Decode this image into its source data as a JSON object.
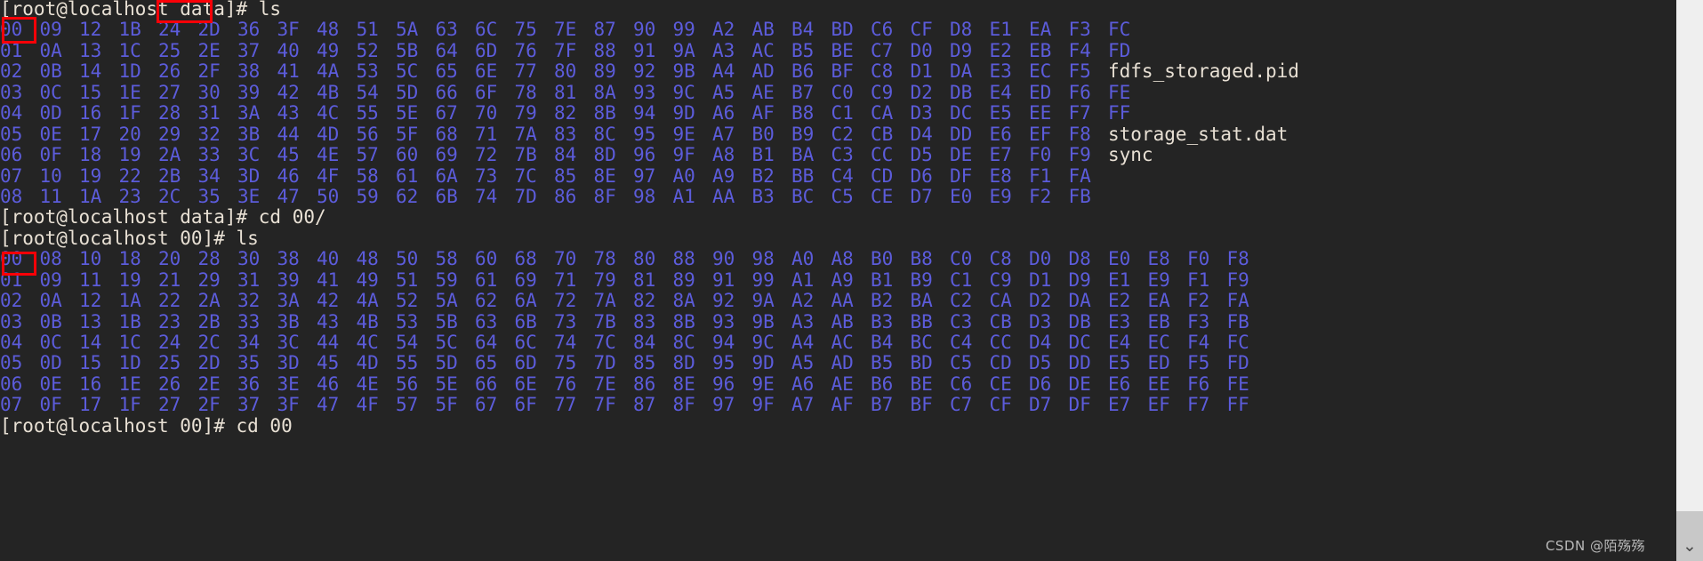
{
  "terminal": {
    "background_color": "#242424",
    "prompt_color": "#e8e0d4",
    "directory_color": "#5c5cdb",
    "filename_color": "#e8e0d4",
    "annotation_color": "#fb0007",
    "lines": [
      {
        "type": "prompt",
        "text": "[root@localhost data]# ls"
      },
      {
        "type": "dirs",
        "cells": [
          "00",
          "09",
          "12",
          "1B",
          "24",
          "2D",
          "36",
          "3F",
          "48",
          "51",
          "5A",
          "63",
          "6C",
          "75",
          "7E",
          "87",
          "90",
          "99",
          "A2",
          "AB",
          "B4",
          "BD",
          "C6",
          "CF",
          "D8",
          "E1",
          "EA",
          "F3",
          "FC"
        ],
        "filename": ""
      },
      {
        "type": "dirs",
        "cells": [
          "01",
          "0A",
          "13",
          "1C",
          "25",
          "2E",
          "37",
          "40",
          "49",
          "52",
          "5B",
          "64",
          "6D",
          "76",
          "7F",
          "88",
          "91",
          "9A",
          "A3",
          "AC",
          "B5",
          "BE",
          "C7",
          "D0",
          "D9",
          "E2",
          "EB",
          "F4",
          "FD"
        ],
        "filename": ""
      },
      {
        "type": "dirs",
        "cells": [
          "02",
          "0B",
          "14",
          "1D",
          "26",
          "2F",
          "38",
          "41",
          "4A",
          "53",
          "5C",
          "65",
          "6E",
          "77",
          "80",
          "89",
          "92",
          "9B",
          "A4",
          "AD",
          "B6",
          "BF",
          "C8",
          "D1",
          "DA",
          "E3",
          "EC",
          "F5"
        ],
        "filename": "fdfs_storaged.pid"
      },
      {
        "type": "dirs",
        "cells": [
          "03",
          "0C",
          "15",
          "1E",
          "27",
          "30",
          "39",
          "42",
          "4B",
          "54",
          "5D",
          "66",
          "6F",
          "78",
          "81",
          "8A",
          "93",
          "9C",
          "A5",
          "AE",
          "B7",
          "C0",
          "C9",
          "D2",
          "DB",
          "E4",
          "ED",
          "F6",
          "FE"
        ],
        "filename": ""
      },
      {
        "type": "dirs",
        "cells": [
          "04",
          "0D",
          "16",
          "1F",
          "28",
          "31",
          "3A",
          "43",
          "4C",
          "55",
          "5E",
          "67",
          "70",
          "79",
          "82",
          "8B",
          "94",
          "9D",
          "A6",
          "AF",
          "B8",
          "C1",
          "CA",
          "D3",
          "DC",
          "E5",
          "EE",
          "F7",
          "FF"
        ],
        "filename": ""
      },
      {
        "type": "dirs",
        "cells": [
          "05",
          "0E",
          "17",
          "20",
          "29",
          "32",
          "3B",
          "44",
          "4D",
          "56",
          "5F",
          "68",
          "71",
          "7A",
          "83",
          "8C",
          "95",
          "9E",
          "A7",
          "B0",
          "B9",
          "C2",
          "CB",
          "D4",
          "DD",
          "E6",
          "EF",
          "F8"
        ],
        "filename": "storage_stat.dat"
      },
      {
        "type": "dirs",
        "cells": [
          "06",
          "0F",
          "18",
          "19",
          "2A",
          "33",
          "3C",
          "45",
          "4E",
          "57",
          "60",
          "69",
          "72",
          "7B",
          "84",
          "8D",
          "96",
          "9F",
          "A8",
          "B1",
          "BA",
          "C3",
          "CC",
          "D5",
          "DE",
          "E7",
          "F0",
          "F9"
        ],
        "filename": "sync"
      },
      {
        "type": "dirs",
        "cells": [
          "07",
          "10",
          "19",
          "22",
          "2B",
          "34",
          "3D",
          "46",
          "4F",
          "58",
          "61",
          "6A",
          "73",
          "7C",
          "85",
          "8E",
          "97",
          "A0",
          "A9",
          "B2",
          "BB",
          "C4",
          "CD",
          "D6",
          "DF",
          "E8",
          "F1",
          "FA"
        ],
        "filename": ""
      },
      {
        "type": "dirs",
        "cells": [
          "08",
          "11",
          "1A",
          "23",
          "2C",
          "35",
          "3E",
          "47",
          "50",
          "59",
          "62",
          "6B",
          "74",
          "7D",
          "86",
          "8F",
          "98",
          "A1",
          "AA",
          "B3",
          "BC",
          "C5",
          "CE",
          "D7",
          "E0",
          "E9",
          "F2",
          "FB"
        ],
        "filename": ""
      },
      {
        "type": "prompt",
        "text": "[root@localhost data]# cd 00/"
      },
      {
        "type": "prompt",
        "text": "[root@localhost 00]# ls"
      },
      {
        "type": "dirs",
        "cells": [
          "00",
          "08",
          "10",
          "18",
          "20",
          "28",
          "30",
          "38",
          "40",
          "48",
          "50",
          "58",
          "60",
          "68",
          "70",
          "78",
          "80",
          "88",
          "90",
          "98",
          "A0",
          "A8",
          "B0",
          "B8",
          "C0",
          "C8",
          "D0",
          "D8",
          "E0",
          "E8",
          "F0",
          "F8"
        ],
        "filename": ""
      },
      {
        "type": "dirs",
        "cells": [
          "01",
          "09",
          "11",
          "19",
          "21",
          "29",
          "31",
          "39",
          "41",
          "49",
          "51",
          "59",
          "61",
          "69",
          "71",
          "79",
          "81",
          "89",
          "91",
          "99",
          "A1",
          "A9",
          "B1",
          "B9",
          "C1",
          "C9",
          "D1",
          "D9",
          "E1",
          "E9",
          "F1",
          "F9"
        ],
        "filename": ""
      },
      {
        "type": "dirs",
        "cells": [
          "02",
          "0A",
          "12",
          "1A",
          "22",
          "2A",
          "32",
          "3A",
          "42",
          "4A",
          "52",
          "5A",
          "62",
          "6A",
          "72",
          "7A",
          "82",
          "8A",
          "92",
          "9A",
          "A2",
          "AA",
          "B2",
          "BA",
          "C2",
          "CA",
          "D2",
          "DA",
          "E2",
          "EA",
          "F2",
          "FA"
        ],
        "filename": ""
      },
      {
        "type": "dirs",
        "cells": [
          "03",
          "0B",
          "13",
          "1B",
          "23",
          "2B",
          "33",
          "3B",
          "43",
          "4B",
          "53",
          "5B",
          "63",
          "6B",
          "73",
          "7B",
          "83",
          "8B",
          "93",
          "9B",
          "A3",
          "AB",
          "B3",
          "BB",
          "C3",
          "CB",
          "D3",
          "DB",
          "E3",
          "EB",
          "F3",
          "FB"
        ],
        "filename": ""
      },
      {
        "type": "dirs",
        "cells": [
          "04",
          "0C",
          "14",
          "1C",
          "24",
          "2C",
          "34",
          "3C",
          "44",
          "4C",
          "54",
          "5C",
          "64",
          "6C",
          "74",
          "7C",
          "84",
          "8C",
          "94",
          "9C",
          "A4",
          "AC",
          "B4",
          "BC",
          "C4",
          "CC",
          "D4",
          "DC",
          "E4",
          "EC",
          "F4",
          "FC"
        ],
        "filename": ""
      },
      {
        "type": "dirs",
        "cells": [
          "05",
          "0D",
          "15",
          "1D",
          "25",
          "2D",
          "35",
          "3D",
          "45",
          "4D",
          "55",
          "5D",
          "65",
          "6D",
          "75",
          "7D",
          "85",
          "8D",
          "95",
          "9D",
          "A5",
          "AD",
          "B5",
          "BD",
          "C5",
          "CD",
          "D5",
          "DD",
          "E5",
          "ED",
          "F5",
          "FD"
        ],
        "filename": ""
      },
      {
        "type": "dirs",
        "cells": [
          "06",
          "0E",
          "16",
          "1E",
          "26",
          "2E",
          "36",
          "3E",
          "46",
          "4E",
          "56",
          "5E",
          "66",
          "6E",
          "76",
          "7E",
          "86",
          "8E",
          "96",
          "9E",
          "A6",
          "AE",
          "B6",
          "BE",
          "C6",
          "CE",
          "D6",
          "DE",
          "E6",
          "EE",
          "F6",
          "FE"
        ],
        "filename": ""
      },
      {
        "type": "dirs",
        "cells": [
          "07",
          "0F",
          "17",
          "1F",
          "27",
          "2F",
          "37",
          "3F",
          "47",
          "4F",
          "57",
          "5F",
          "67",
          "6F",
          "77",
          "7F",
          "87",
          "8F",
          "97",
          "9F",
          "A7",
          "AF",
          "B7",
          "BF",
          "C7",
          "CF",
          "D7",
          "DF",
          "E7",
          "EF",
          "F7",
          "FF"
        ],
        "filename": ""
      },
      {
        "type": "prompt",
        "text": "[root@localhost 00]# cd 00"
      }
    ]
  },
  "annotations": [
    {
      "name": "data-directory-highlight",
      "label": "data"
    },
    {
      "name": "first-00-highlight",
      "label": "00"
    },
    {
      "name": "second-00-highlight",
      "label": "00"
    }
  ],
  "scrollbar": {
    "caret_glyph": "⌄"
  },
  "watermark": {
    "text": "CSDN @陌殇殇"
  }
}
